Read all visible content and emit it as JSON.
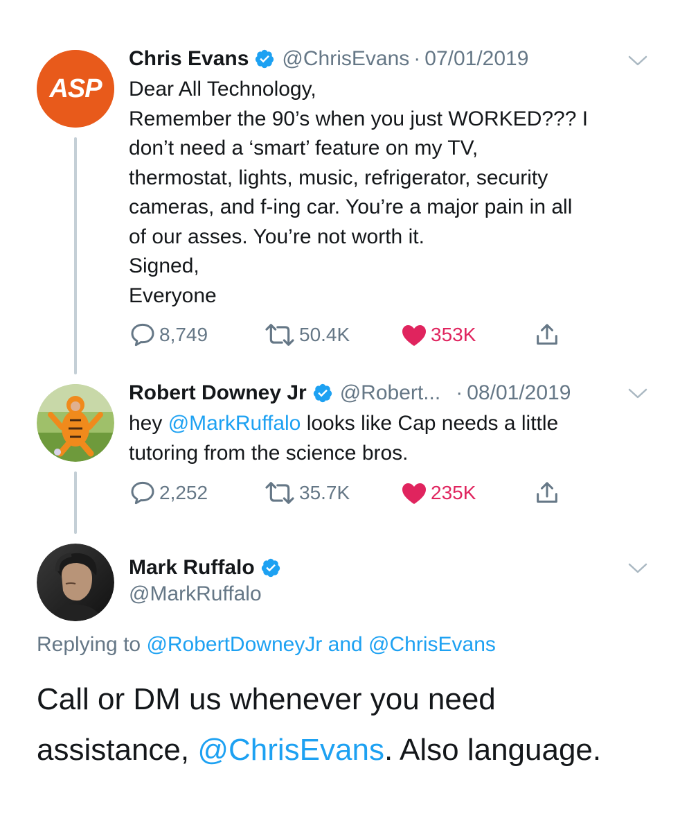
{
  "tweets": [
    {
      "name": "Chris Evans",
      "handle": "@ChrisEvans",
      "date": "07/01/2019",
      "avatar_text": "ASP",
      "lines": [
        "Dear All Technology,",
        "Remember the 90’s when you just WORKED??? I",
        "don’t need a ‘smart’ feature on my TV,",
        "thermostat, lights, music, refrigerator, security",
        "cameras, and f-ing car. You’re a major pain in all",
        "of our asses. You’re not worth it.",
        "Signed,",
        "Everyone"
      ],
      "replies": "8,749",
      "retweets": "50.4K",
      "likes": "353K"
    },
    {
      "name": "Robert Downey Jr",
      "handle": "@Robert...",
      "date": "08/01/2019",
      "text_prefix": "hey ",
      "mention": "@MarkRuffalo",
      "text_suffix": " looks like Cap needs a little",
      "line2": "tutoring from the science bros.",
      "replies": "2,252",
      "retweets": "35.7K",
      "likes": "235K"
    }
  ],
  "main": {
    "name": "Mark Ruffalo",
    "handle": "@MarkRuffalo",
    "replying_prefix": "Replying to ",
    "replying_to_1": "@RobertDowneyJr",
    "replying_and": " and ",
    "replying_to_2": "@ChrisEvans",
    "line1": "Call or DM us whenever you need",
    "line2_prefix": "assistance, ",
    "line2_mention": "@ChrisEvans",
    "line2_suffix": ". Also language."
  },
  "colors": {
    "link": "#1da1f2",
    "secondary_text": "#657786",
    "like": "#e0245e",
    "verified": "#1da1f2",
    "thread_line": "#c4cfd6",
    "asp_orange": "#e85a1b"
  },
  "icons": [
    "verified-badge-icon",
    "chevron-down-icon",
    "reply-icon",
    "retweet-icon",
    "heart-icon",
    "share-icon"
  ]
}
